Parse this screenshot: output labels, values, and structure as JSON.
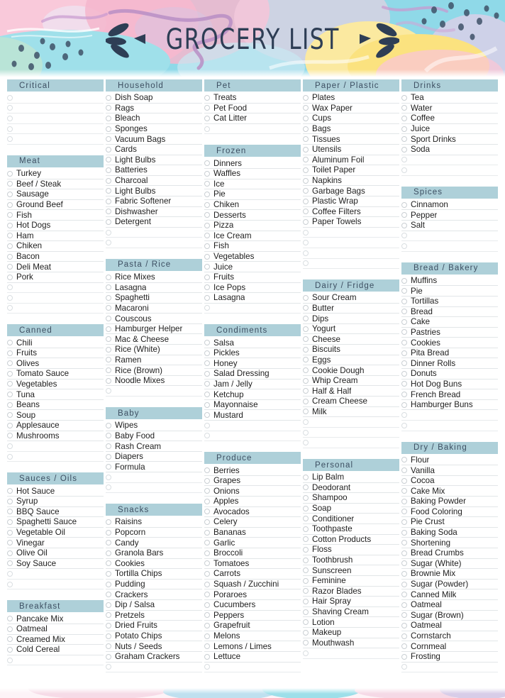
{
  "header": {
    "title": "Grocery List",
    "left_ornament": "leaf-cluster-icon",
    "right_ornament": "leaf-cluster-icon"
  },
  "theme": {
    "header_bar_color": "#aed0d9",
    "header_text_color": "#3d4f62",
    "item_text_color": "#1d1d1d",
    "bubble_border_color": "#c9cfd3",
    "rule_color": "#e2e6e8",
    "title_color": "#2e3e55",
    "page_background": "#ffffff"
  },
  "columns": [
    {
      "name": "column-1",
      "sections": [
        {
          "title": "Critical",
          "items": [],
          "blank_rows": 5
        },
        {
          "title": "Meat",
          "items": [
            "Turkey",
            "Beef / Steak",
            "Sausage",
            "Ground Beef",
            "Fish",
            "Hot Dogs",
            "Ham",
            "Chiken",
            "Bacon",
            "Deli Meat",
            "Pork"
          ],
          "blank_rows": 3
        },
        {
          "title": "Canned",
          "items": [
            "Chili",
            "Fruits",
            "Olives",
            "Tomato Sauce",
            "Vegetables",
            "Tuna",
            "Beans",
            "Soup",
            "Applesauce",
            "Mushrooms"
          ],
          "blank_rows": 2
        },
        {
          "title": "Sauces / Oils",
          "items": [
            "Hot Sauce",
            "Syrup",
            "BBQ Sauce",
            "Spaghetti Sauce",
            "Vegetable Oil",
            "Vinegar",
            "Olive Oil",
            "Soy Sauce"
          ],
          "blank_rows": 2
        },
        {
          "title": "Breakfast",
          "items": [
            "Pancake Mix",
            "Oatmeal",
            "Creamed Mix",
            "Cold Cereal"
          ],
          "blank_rows": 1
        }
      ]
    },
    {
      "name": "column-2",
      "sections": [
        {
          "title": "Household",
          "items": [
            "Dish Soap",
            "Rags",
            "Bleach",
            "Sponges",
            "Vacuum Bags",
            "Cards",
            "Light Bulbs",
            "Batteries",
            "Charcoal",
            "Light Bulbs",
            "Fabric Softener",
            "Dishwasher",
            "Detergent"
          ],
          "blank_rows": 2
        },
        {
          "title": "Pasta / Rice",
          "items": [
            "Rice Mixes",
            "Lasagna",
            "Spaghetti",
            "Macaroni",
            "Couscous",
            "Hamburger Helper",
            "Mac & Cheese",
            "Rice (White)",
            "Ramen",
            "Rice (Brown)",
            "Noodle Mixes"
          ],
          "blank_rows": 1
        },
        {
          "title": "Baby",
          "items": [
            "Wipes",
            "Baby Food",
            "Rash Cream",
            "Diapers",
            "Formula"
          ],
          "blank_rows": 2
        },
        {
          "title": "Snacks",
          "items": [
            "Raisins",
            "Popcorn",
            "Candy",
            "Granola Bars",
            "Cookies",
            "Tortilla Chips",
            "Pudding",
            "Crackers",
            "Dip / Salsa",
            "Pretzels",
            "Dried Fruits",
            "Potato Chips",
            "Nuts / Seeds",
            "Graham Crackers"
          ],
          "blank_rows": 1
        }
      ]
    },
    {
      "name": "column-3",
      "sections": [
        {
          "title": "Pet",
          "items": [
            "Treats",
            "Pet Food",
            "Cat Litter"
          ],
          "blank_rows": 1
        },
        {
          "title": "Frozen",
          "items": [
            "Dinners",
            "Waffles",
            "Ice",
            "Pie",
            "Chiken",
            "Desserts",
            "Pizza",
            "Ice Cream",
            "Fish",
            "Vegetables",
            "Juice",
            "Fruits",
            "Ice Pops",
            "Lasagna"
          ],
          "blank_rows": 1
        },
        {
          "title": "Condiments",
          "items": [
            "Salsa",
            "Pickles",
            "Honey",
            "Salad Dressing",
            "Jam / Jelly",
            "Ketchup",
            "Mayonnaise",
            "Mustard"
          ],
          "blank_rows": 2
        },
        {
          "title": "Produce",
          "items": [
            "Berries",
            "Grapes",
            "Onions",
            "Apples",
            "Avocados",
            "Celery",
            "Bananas",
            "Garlic",
            "Broccoli",
            "Tomatoes",
            "Carrots",
            "Squash / Zucchini",
            "Poraroes",
            "Cucumbers",
            "Peppers",
            "Grapefruit",
            "Melons",
            "Lemons / Limes",
            "Lettuce"
          ],
          "blank_rows": 1
        }
      ]
    },
    {
      "name": "column-4",
      "sections": [
        {
          "title": "Paper / Plastic",
          "items": [
            "Plates",
            "Wax Paper",
            "Cups",
            "Bags",
            "Tissues",
            "Utensils",
            "Aluminum Foil",
            "Toilet Paper",
            "Napkins",
            "Garbage Bags",
            "Plastic Wrap",
            "Coffee Filters",
            "Paper Towels"
          ],
          "blank_rows": 4
        },
        {
          "title": "Dairy / Fridge",
          "items": [
            "Sour Cream",
            "Butter",
            "Dips",
            "Yogurt",
            "Cheese",
            "Biscuits",
            "Eggs",
            "Cookie Dough",
            "Whip Cream",
            "Half & Half",
            "Cream Cheese",
            "Milk"
          ],
          "blank_rows": 3
        },
        {
          "title": "Personal",
          "items": [
            "Lip Balm",
            "Deodorant",
            "Shampoo",
            "Soap",
            "Conditioner",
            "Toothpaste",
            "Cotton Products",
            "Floss",
            "Toothbrush",
            "Sunscreen",
            "Feminine",
            "Razor Blades",
            "Hair Spray",
            "Shaving Cream",
            "Lotion",
            "Makeup",
            "Mouthwash"
          ],
          "blank_rows": 1
        }
      ]
    },
    {
      "name": "column-5",
      "sections": [
        {
          "title": "Drinks",
          "items": [
            "Tea",
            "Water",
            "Coffee",
            "Juice",
            "Sport Drinks",
            "Soda"
          ],
          "blank_rows": 2
        },
        {
          "title": "Spices",
          "items": [
            "Cinnamon",
            "Pepper",
            "Salt"
          ],
          "blank_rows": 2
        },
        {
          "title": "Bread / Bakery",
          "items": [
            "Muffins",
            "Pie",
            "Tortillas",
            "Bread",
            "Cake",
            "Pastries",
            "Cookies",
            "Pita Bread",
            "Dinner Rolls",
            "Donuts",
            "Hot Dog Buns",
            "French Bread",
            "Hamburger Buns"
          ],
          "blank_rows": 2
        },
        {
          "title": "Dry / Baking",
          "items": [
            "Flour",
            "Vanilla",
            "Cocoa",
            "Cake Mix",
            "Baking Powder",
            "Food Coloring",
            "Pie Crust",
            "Baking Soda",
            "Shortening",
            "Bread Crumbs",
            "Sugar (White)",
            "Brownie Mix",
            "Sugar (Powder)",
            "Canned Milk",
            "Oatmeal",
            "Sugar (Brown)",
            "Oatmeal",
            "Cornstarch",
            "Cornmeal",
            "Frosting"
          ],
          "blank_rows": 1
        }
      ]
    }
  ]
}
